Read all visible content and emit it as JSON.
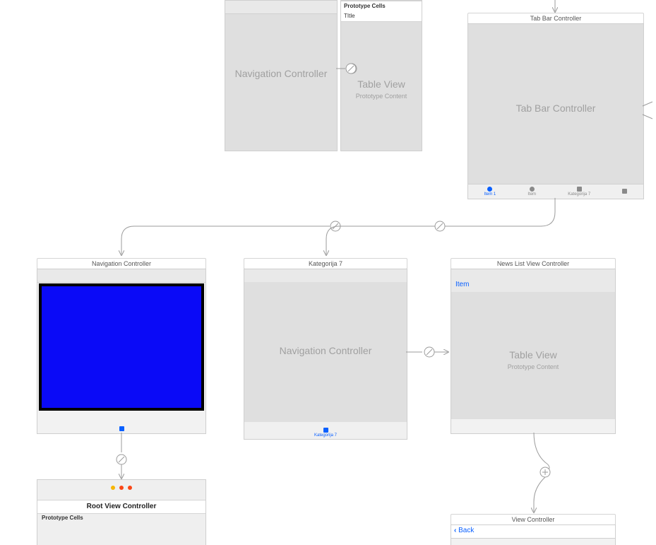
{
  "top": {
    "nav": {
      "title": "Navigation Controller"
    },
    "table": {
      "proto_header": "Prototype Cells",
      "cell_title": "TItle",
      "title": "Table View",
      "subtitle": "Prototype Content"
    },
    "tabbar_label": "Tab Bar Controller",
    "tabbar": {
      "title": "Tab Bar Controller",
      "items": [
        {
          "label": "Item 1",
          "active": true,
          "shape": "ci"
        },
        {
          "label": "Item",
          "active": false,
          "shape": "ci"
        },
        {
          "label": "Kategorija 7",
          "active": false,
          "shape": "sq"
        },
        {
          "label": "",
          "active": false,
          "shape": "sq"
        }
      ]
    }
  },
  "mid": {
    "navA": {
      "label": "Navigation Controller"
    },
    "navB": {
      "label": "Kategorija 7",
      "title": "Navigation Controller",
      "tab_label": "Kategorija 7"
    },
    "news": {
      "label": "News List View Controller",
      "item": "Item",
      "title": "Table View",
      "subtitle": "Prototype Content"
    }
  },
  "bottom": {
    "root": {
      "title": "Root View Controller",
      "proto_header": "Prototype Cells"
    },
    "vc": {
      "label": "View Controller",
      "back": "Back"
    }
  }
}
